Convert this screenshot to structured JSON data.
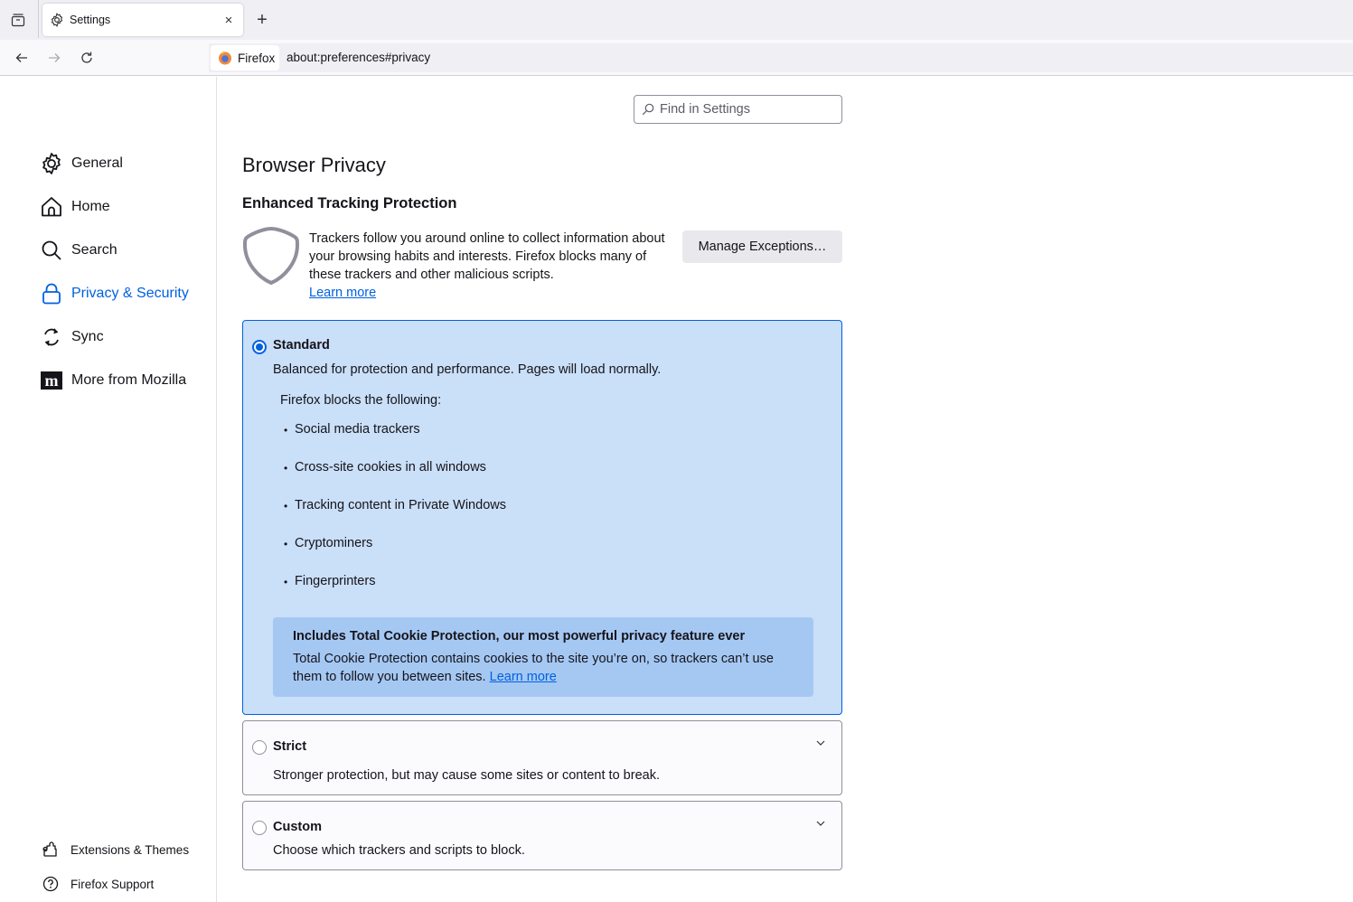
{
  "tabstrip": {
    "tab_title": "Settings",
    "close_label": "×",
    "new_tab_label": "+"
  },
  "navbar": {
    "identity_label": "Firefox",
    "url": "about:preferences#privacy"
  },
  "sidebar": {
    "items": [
      {
        "label": "General",
        "icon": "gear-icon"
      },
      {
        "label": "Home",
        "icon": "home-icon"
      },
      {
        "label": "Search",
        "icon": "search-icon"
      },
      {
        "label": "Privacy & Security",
        "icon": "lock-icon",
        "selected": true
      },
      {
        "label": "Sync",
        "icon": "sync-icon"
      },
      {
        "label": "More from Mozilla",
        "icon": "mozilla-icon"
      }
    ],
    "footer": [
      {
        "label": "Extensions & Themes",
        "icon": "puzzle-icon"
      },
      {
        "label": "Firefox Support",
        "icon": "help-icon"
      }
    ]
  },
  "search": {
    "placeholder": "Find in Settings",
    "value": ""
  },
  "main": {
    "page_title": "Browser Privacy",
    "section_title": "Enhanced Tracking Protection",
    "etp_description": "Trackers follow you around online to collect information about your browsing habits and interests. Firefox blocks many of these trackers and other malicious scripts.",
    "learn_more": "Learn more",
    "manage_exceptions_label": "Manage Exceptions…",
    "options": {
      "standard": {
        "label": "Standard",
        "selected": true,
        "description": "Balanced for protection and performance. Pages will load normally.",
        "blocks_title": "Firefox blocks the following:",
        "blocks": [
          "Social media trackers",
          "Cross-site cookies in all windows",
          "Tracking content in Private Windows",
          "Cryptominers",
          "Fingerprinters"
        ],
        "tcp_title": "Includes Total Cookie Protection, our most powerful privacy feature ever",
        "tcp_description": "Total Cookie Protection contains cookies to the site you’re on, so trackers can’t use them to follow you between sites.",
        "tcp_learn_more": "Learn more"
      },
      "strict": {
        "label": "Strict",
        "selected": false,
        "description": "Stronger protection, but may cause some sites or content to break."
      },
      "custom": {
        "label": "Custom",
        "selected": false,
        "description": "Choose which trackers and scripts to block."
      }
    }
  },
  "colors": {
    "accent": "#0061e0",
    "selected_card_bg": "#cadff8",
    "tcp_bg": "#a5c8f3",
    "tabstrip_bg": "#f0eff4"
  }
}
